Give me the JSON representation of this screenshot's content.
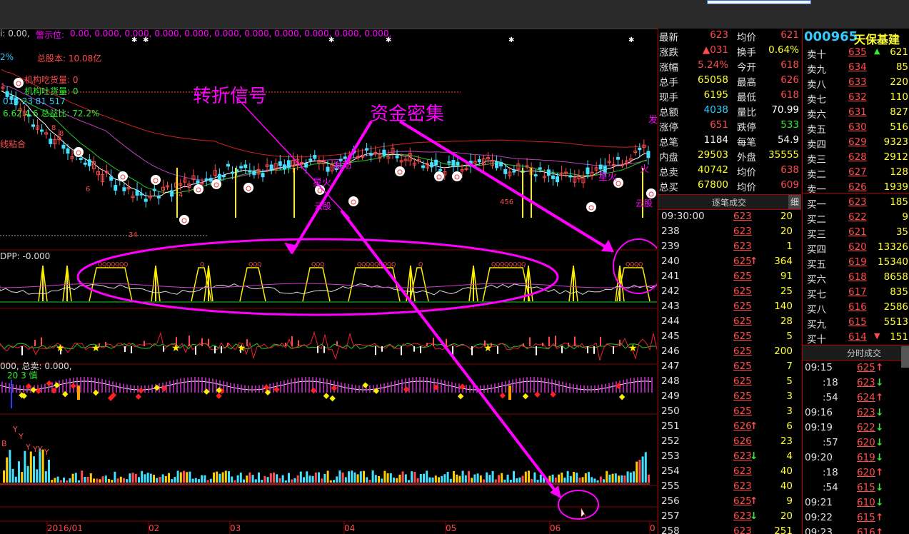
{
  "header": {
    "indicator_prefix": "i: 0.00,",
    "alarm_label": "警示位:",
    "alarm_values": "0.00, 0.000, 0.000, 0.000, 0.000, 0.000, 0.000, 0.000, 0.000, 0.000, 0.000,",
    "total_shares": "总股本: 10.08亿",
    "inst_buy": "机构吃货量: 0",
    "inst_sell": "机构吐货量: 0",
    "line_a": "013 23 81 517",
    "line_b": "6.62 4.6 总益比: 72.2%",
    "pct": "2%",
    "xianzhan": "线粘合",
    "sub1_label": "DPP: -0.000",
    "sub3_label": "000, 总卖: 0.000,",
    "sub3_nums": "20     3     慎"
  },
  "annotations": {
    "turn_signal": "转折信号",
    "fund_dense": "资金密集"
  },
  "chart_text": {
    "fa": "发",
    "faqi": "发",
    "xinghuo": "星火",
    "yunbu": "云股",
    "huo": "火",
    "fa_left": "发动",
    "xinghuo_left": "星火",
    "cloud_b": "云股"
  },
  "x_axis": [
    "2016/01",
    "02",
    "03",
    "04",
    "05",
    "06",
    "0"
  ],
  "stock": {
    "code": "000965",
    "name": "天保基建"
  },
  "quote": [
    {
      "l1": "最新",
      "v1": "623",
      "c1": "red",
      "l2": "均价",
      "v2": "621",
      "c2": "red"
    },
    {
      "l1": "涨跌",
      "v1": "▲031",
      "c1": "red",
      "l2": "换手",
      "v2": "0.64%",
      "c2": "yellow"
    },
    {
      "l1": "涨幅",
      "v1": "5.24%",
      "c1": "red",
      "l2": "今开",
      "v2": "618",
      "c2": "red"
    },
    {
      "l1": "总手",
      "v1": "65058",
      "c1": "yellow",
      "l2": "最高",
      "v2": "626",
      "c2": "red"
    },
    {
      "l1": "现手",
      "v1": "6195",
      "c1": "yellow",
      "l2": "最低",
      "v2": "618",
      "c2": "red"
    },
    {
      "l1": "总额",
      "v1": "4038",
      "c1": "cyan",
      "l2": "量比",
      "v2": "70.99",
      "c2": "white"
    },
    {
      "l1": "涨停",
      "v1": "651",
      "c1": "red",
      "l2": "跌停",
      "v2": "533",
      "c2": "green"
    },
    {
      "l1": "总笔",
      "v1": "1184",
      "c1": "white",
      "l2": "每笔",
      "v2": "54.9",
      "c2": "white"
    },
    {
      "l1": "内盘",
      "v1": "29503",
      "c1": "yellow",
      "l2": "外盘",
      "v2": "35555",
      "c2": "yellow"
    },
    {
      "l1": "总卖",
      "v1": "40742",
      "c1": "yellow",
      "l2": "均价",
      "v2": "638",
      "c2": "red"
    },
    {
      "l1": "总买",
      "v1": "67800",
      "c1": "yellow",
      "l2": "均价",
      "v2": "609",
      "c2": "red"
    }
  ],
  "order_book": [
    {
      "l": "卖十",
      "p": "635",
      "v": "621",
      "mark": "▲"
    },
    {
      "l": "卖九",
      "p": "634",
      "v": "85",
      "mark": ""
    },
    {
      "l": "卖八",
      "p": "633",
      "v": "220",
      "mark": ""
    },
    {
      "l": "卖七",
      "p": "632",
      "v": "110",
      "mark": ""
    },
    {
      "l": "卖六",
      "p": "631",
      "v": "827",
      "mark": ""
    },
    {
      "l": "卖五",
      "p": "630",
      "v": "516",
      "mark": ""
    },
    {
      "l": "卖四",
      "p": "629",
      "v": "9323",
      "mark": ""
    },
    {
      "l": "卖三",
      "p": "628",
      "v": "2912",
      "mark": ""
    },
    {
      "l": "卖二",
      "p": "627",
      "v": "128",
      "mark": ""
    },
    {
      "l": "卖一",
      "p": "626",
      "v": "1939",
      "mark": ""
    },
    {
      "l": "买一",
      "p": "623",
      "v": "185",
      "mark": ""
    },
    {
      "l": "买二",
      "p": "622",
      "v": "9",
      "mark": ""
    },
    {
      "l": "买三",
      "p": "621",
      "v": "35",
      "mark": ""
    },
    {
      "l": "买四",
      "p": "620",
      "v": "13326",
      "mark": ""
    },
    {
      "l": "买五",
      "p": "619",
      "v": "15340",
      "mark": ""
    },
    {
      "l": "买六",
      "p": "618",
      "v": "8658",
      "mark": ""
    },
    {
      "l": "买七",
      "p": "617",
      "v": "835",
      "mark": ""
    },
    {
      "l": "买八",
      "p": "616",
      "v": "2586",
      "mark": ""
    },
    {
      "l": "买九",
      "p": "615",
      "v": "5513",
      "mark": ""
    },
    {
      "l": "买十",
      "p": "614",
      "v": "151",
      "mark": "▼"
    }
  ],
  "trades_tab": {
    "title": "逐笔成交",
    "detail": "细"
  },
  "trades": [
    {
      "t": "09:30:00",
      "p": "623",
      "v": "20",
      "a": ""
    },
    {
      "t": "238",
      "p": "623",
      "v": "20",
      "a": ""
    },
    {
      "t": "239",
      "p": "623",
      "v": "1",
      "a": ""
    },
    {
      "t": "240",
      "p": "625",
      "v": "364",
      "a": "↑"
    },
    {
      "t": "241",
      "p": "625",
      "v": "91",
      "a": ""
    },
    {
      "t": "242",
      "p": "625",
      "v": "25",
      "a": ""
    },
    {
      "t": "243",
      "p": "625",
      "v": "140",
      "a": ""
    },
    {
      "t": "244",
      "p": "625",
      "v": "28",
      "a": ""
    },
    {
      "t": "245",
      "p": "625",
      "v": "5",
      "a": ""
    },
    {
      "t": "246",
      "p": "625",
      "v": "200",
      "a": ""
    },
    {
      "t": "247",
      "p": "625",
      "v": "7",
      "a": ""
    },
    {
      "t": "248",
      "p": "625",
      "v": "5",
      "a": ""
    },
    {
      "t": "249",
      "p": "625",
      "v": "3",
      "a": ""
    },
    {
      "t": "250",
      "p": "625",
      "v": "3",
      "a": ""
    },
    {
      "t": "251",
      "p": "626",
      "v": "6",
      "a": "↑"
    },
    {
      "t": "252",
      "p": "626",
      "v": "23",
      "a": ""
    },
    {
      "t": "253",
      "p": "623",
      "v": "4",
      "a": "↓"
    },
    {
      "t": "254",
      "p": "623",
      "v": "40",
      "a": ""
    },
    {
      "t": "255",
      "p": "623",
      "v": "40",
      "a": ""
    },
    {
      "t": "256",
      "p": "625",
      "v": "9",
      "a": "↑"
    },
    {
      "t": "257",
      "p": "623",
      "v": "20",
      "a": "↓"
    },
    {
      "t": "258",
      "p": "623",
      "v": "251",
      "a": ""
    }
  ],
  "fenshi_tab": {
    "title": "分时成交"
  },
  "fenshi": [
    {
      "t": "09:15",
      "p": "625",
      "a": "↑"
    },
    {
      "t": ":18",
      "p": "623",
      "a": "↓"
    },
    {
      "t": ":54",
      "p": "624",
      "a": "↑"
    },
    {
      "t": "09:16",
      "p": "623",
      "a": "↓"
    },
    {
      "t": "09:19",
      "p": "622",
      "a": "↓"
    },
    {
      "t": ":57",
      "p": "620",
      "a": "↓"
    },
    {
      "t": "09:20",
      "p": "619",
      "a": "↓"
    },
    {
      "t": ":18",
      "p": "620",
      "a": "↑"
    },
    {
      "t": ":54",
      "p": "615",
      "a": "↓"
    },
    {
      "t": "09:21",
      "p": "610",
      "a": "↓"
    },
    {
      "t": "09:22",
      "p": "615",
      "a": "↑"
    },
    {
      "t": "09:23",
      "p": "616",
      "a": "↑"
    }
  ],
  "colors": {
    "up": "#ff4b4b",
    "down": "#33ee33",
    "accent": "#ff00ff",
    "frame": "#b00000",
    "label": "#ffff33"
  }
}
